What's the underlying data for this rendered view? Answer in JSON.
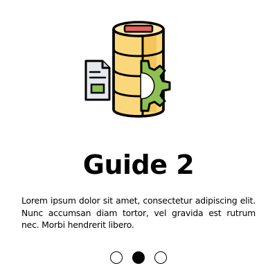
{
  "illustration": {
    "icon": "database-gear-document-icon",
    "colors": {
      "cylinder": "#FAD87A",
      "cylinder_shade": "#F3C55A",
      "label_bar": "#E8615A",
      "gear": "#8CC152",
      "document": "#E6E9EE",
      "document_mark": "#8CC152",
      "outline": "#000000"
    }
  },
  "title": "Guide 2",
  "body": "Lorem ipsum dolor sit amet, consectetur adipiscing elit. Nunc accumsan diam tortor, vel gravida est rutrum nec. Morbi hendrerit libero.",
  "pager": {
    "total": 3,
    "active_index": 1
  }
}
